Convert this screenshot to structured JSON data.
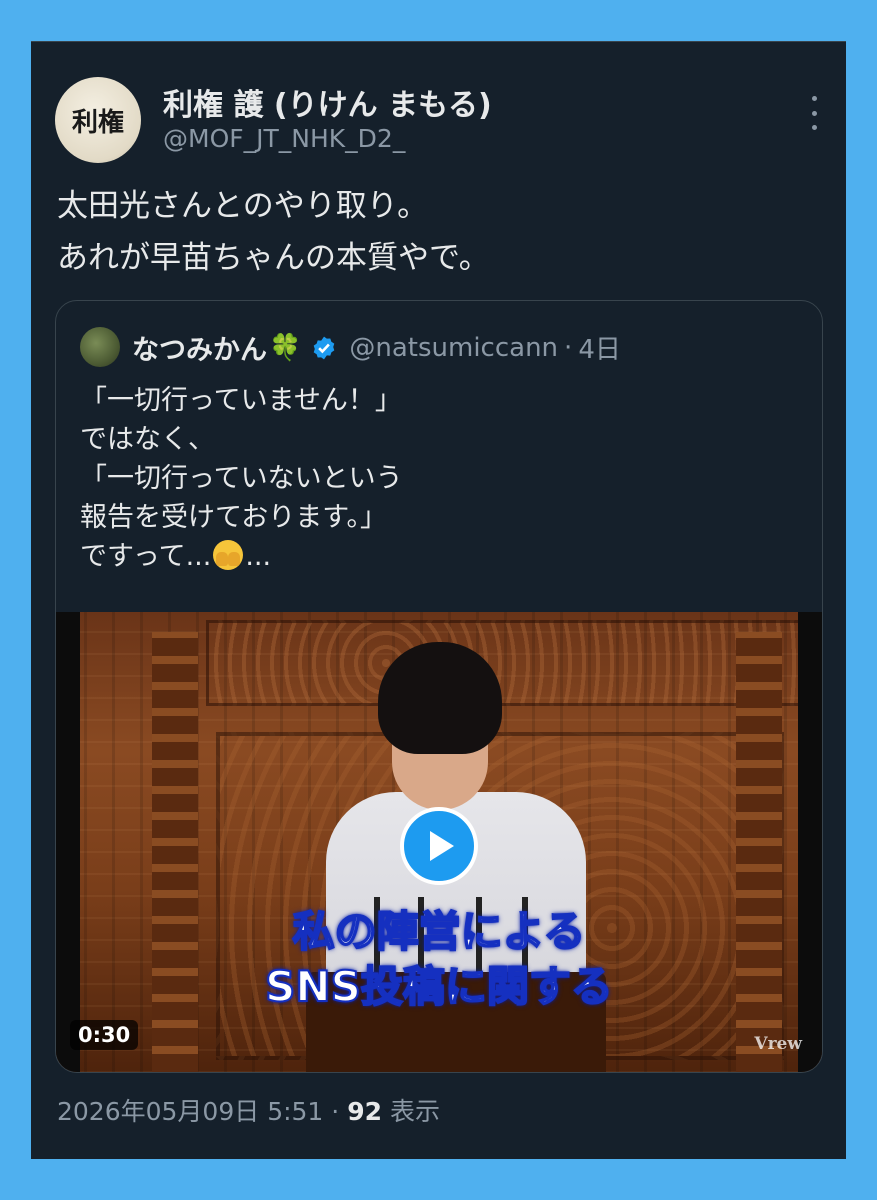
{
  "tweet": {
    "avatar_text": "利権",
    "display_name": "利権 護 (りけん まもる)",
    "handle": "@MOF_JT_NHK_D2_",
    "text_lines": [
      "太田光さんとのやり取り。",
      "あれが早苗ちゃんの本質やで。"
    ],
    "date": "2026年05月09日 5:51",
    "separator": "·",
    "views": "92",
    "views_label": "表示"
  },
  "quote": {
    "display_name": "なつみかん",
    "name_emoji": "🍀",
    "handle": "@natsumiccann",
    "separator": "·",
    "time": "4日",
    "text_lines": [
      "「一切行っていません！」",
      "ではなく、",
      "「一切行っていないという",
      "報告を受けております。」"
    ],
    "last_line_before": "ですって...",
    "last_line_after": "...",
    "video": {
      "caption_line1": "私の陣営による",
      "caption_line2": "SNS投稿に関する",
      "duration": "0:30",
      "watermark": "Vrew"
    }
  },
  "colors": {
    "background": "#4fb0ef",
    "card": "#15202b",
    "text_primary": "#e7e9ea",
    "text_secondary": "#8b98a5",
    "accent": "#1d9bf0",
    "caption_outline": "#1530c0"
  },
  "icons": [
    "more-icon",
    "verified-badge-icon",
    "play-icon",
    "face-with-hand-over-mouth-emoji"
  ]
}
